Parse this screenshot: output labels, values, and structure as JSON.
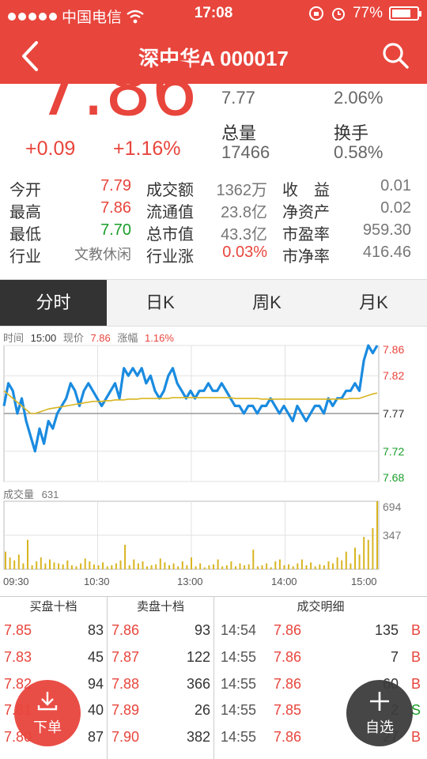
{
  "status_bar": {
    "carrier": "中国电信",
    "time": "17:08",
    "battery": "77%",
    "battery_level": 0.77
  },
  "nav": {
    "title": "深中华A 000017"
  },
  "quote": {
    "price": "7.86",
    "change": "+0.09",
    "change_pct": "+1.16%",
    "cells": [
      {
        "label": "",
        "value": "7.77"
      },
      {
        "label": "",
        "value": "2.06%"
      },
      {
        "label": "总量",
        "value": "17466"
      },
      {
        "label": "换手",
        "value": "0.58%"
      }
    ]
  },
  "stats": {
    "rows": [
      {
        "l1": "今开",
        "v1": "7.79",
        "l2": "成交额",
        "v2": "1362万",
        "l3": "收　益",
        "v3": "0.01"
      },
      {
        "l1": "最高",
        "v1": "7.86",
        "l2": "流通值",
        "v2": "23.8亿",
        "l3": "净资产",
        "v3": "0.02"
      },
      {
        "l1": "最低",
        "v1": "7.70",
        "l2": "总市值",
        "v2": "43.3亿",
        "l3": "市盈率",
        "v3": "959.30"
      },
      {
        "l1": "行业",
        "v1": "文教休闲",
        "l2": "行业涨",
        "v2": "0.03%",
        "l3": "市净率",
        "v3": "416.46"
      }
    ]
  },
  "tabs": [
    "分时",
    "日K",
    "周K",
    "月K"
  ],
  "chart_info": {
    "time_label": "时间",
    "time": "15:00",
    "price_label": "现价",
    "price": "7.86",
    "pct_label": "涨幅",
    "pct": "1.16%",
    "volume_label": "成交量",
    "volume": "631"
  },
  "colors": {
    "accent": "#e8453c",
    "price_line": "#1a8be0",
    "avg_line": "#d8b521",
    "volume_bar": "#d8b521",
    "up": "#e8453c",
    "down": "#1a9e2a"
  },
  "chart_data": {
    "type": "line",
    "title": "",
    "xlabel": "",
    "ylabel": "",
    "y_ticks": [
      "7.86",
      "7.82",
      "7.77",
      "7.72",
      "7.68"
    ],
    "ylim": [
      7.68,
      7.86
    ],
    "x_ticks": [
      "09:30",
      "10:30",
      "13:00",
      "14:00",
      "15:00"
    ],
    "volume_ticks": [
      "694",
      "347"
    ],
    "volume_max": 694,
    "series": [
      {
        "values": [
          7.78,
          7.81,
          7.8,
          7.77,
          7.79,
          7.76,
          7.74,
          7.72,
          7.75,
          7.73,
          7.76,
          7.75,
          7.77,
          7.78,
          7.79,
          7.81,
          7.8,
          7.78,
          7.8,
          7.81,
          7.8,
          7.79,
          7.78,
          7.79,
          7.8,
          7.81,
          7.79,
          7.83,
          7.82,
          7.83,
          7.82,
          7.83,
          7.81,
          7.82,
          7.8,
          7.79,
          7.8,
          7.82,
          7.83,
          7.81,
          7.8,
          7.79,
          7.8,
          7.79,
          7.8,
          7.8,
          7.81,
          7.8,
          7.8,
          7.81,
          7.8,
          7.79,
          7.78,
          7.78,
          7.77,
          7.78,
          7.78,
          7.77,
          7.78,
          7.78,
          7.79,
          7.78,
          7.77,
          7.78,
          7.77,
          7.76,
          7.78,
          7.77,
          7.76,
          7.77,
          7.78,
          7.78,
          7.77,
          7.79,
          7.78,
          7.79,
          7.79,
          7.8,
          7.8,
          7.81,
          7.8,
          7.84,
          7.86,
          7.85,
          7.86
        ]
      },
      {
        "values": [
          7.8,
          7.795,
          7.79,
          7.785,
          7.78,
          7.775,
          7.77,
          7.77,
          7.772,
          7.774,
          7.776,
          7.777,
          7.778,
          7.779,
          7.78,
          7.781,
          7.782,
          7.783,
          7.784,
          7.785,
          7.786,
          7.786,
          7.786,
          7.787,
          7.787,
          7.788,
          7.788,
          7.788,
          7.789,
          7.789,
          7.789,
          7.79,
          7.79,
          7.79,
          7.79,
          7.79,
          7.79,
          7.79,
          7.791,
          7.791,
          7.791,
          7.791,
          7.791,
          7.791,
          7.791,
          7.791,
          7.791,
          7.791,
          7.791,
          7.791,
          7.791,
          7.791,
          7.79,
          7.79,
          7.79,
          7.79,
          7.79,
          7.79,
          7.789,
          7.789,
          7.789,
          7.789,
          7.789,
          7.789,
          7.789,
          7.789,
          7.789,
          7.789,
          7.789,
          7.789,
          7.789,
          7.789,
          7.789,
          7.789,
          7.789,
          7.789,
          7.789,
          7.789,
          7.79,
          7.79,
          7.79,
          7.792,
          7.794,
          7.796,
          7.797
        ]
      }
    ],
    "volume": [
      180,
      120,
      90,
      150,
      60,
      300,
      40,
      80,
      120,
      60,
      100,
      70,
      60,
      50,
      90,
      40,
      30,
      60,
      110,
      80,
      50,
      40,
      70,
      30,
      40,
      60,
      90,
      250,
      40,
      100,
      60,
      80,
      30,
      40,
      50,
      110,
      70,
      40,
      60,
      30,
      80,
      40,
      120,
      30,
      60,
      20,
      40,
      50,
      100,
      30,
      40,
      80,
      30,
      60,
      40,
      50,
      200,
      30,
      40,
      60,
      20,
      80,
      100,
      40,
      50,
      30,
      60,
      100,
      40,
      70,
      30,
      50,
      40,
      80,
      60,
      120,
      90,
      180,
      60,
      220,
      150,
      330,
      300,
      420,
      694
    ]
  },
  "order_book": {
    "headers": [
      "买盘十档",
      "卖盘十档",
      "成交明细"
    ],
    "buy": [
      {
        "price": "7.85",
        "vol": "83"
      },
      {
        "price": "7.83",
        "vol": "45"
      },
      {
        "price": "7.82",
        "vol": "94"
      },
      {
        "price": "7.81",
        "vol": "40"
      },
      {
        "price": "7.80",
        "vol": "87"
      }
    ],
    "sell": [
      {
        "price": "7.86",
        "vol": "93"
      },
      {
        "price": "7.87",
        "vol": "122"
      },
      {
        "price": "7.88",
        "vol": "366"
      },
      {
        "price": "7.89",
        "vol": "26"
      },
      {
        "price": "7.90",
        "vol": "382"
      }
    ],
    "trades": [
      {
        "time": "14:54",
        "price": "7.86",
        "vol": "135",
        "side": "B"
      },
      {
        "time": "14:55",
        "price": "7.86",
        "vol": "7",
        "side": "B"
      },
      {
        "time": "14:55",
        "price": "7.86",
        "vol": "60",
        "side": "B"
      },
      {
        "time": "14:55",
        "price": "7.85",
        "vol": "2",
        "side": "S"
      },
      {
        "time": "14:55",
        "price": "7.86",
        "vol": "27",
        "side": "B"
      }
    ]
  },
  "fab": {
    "buy_label": "下单",
    "fav_label": "自选"
  }
}
